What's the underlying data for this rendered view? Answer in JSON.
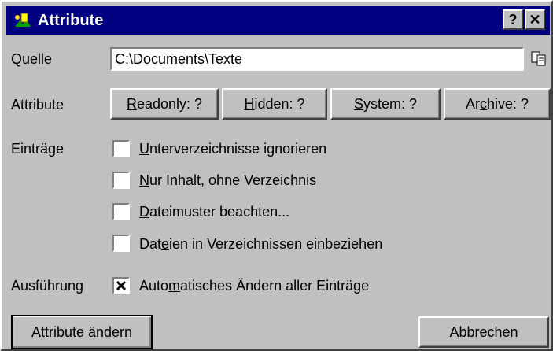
{
  "window": {
    "title": "Attribute",
    "help_label": "?",
    "close_label": "✕"
  },
  "quelle": {
    "label": "Quelle",
    "value": "C:\\Documents\\Texte",
    "browse_icon": "copy-icon"
  },
  "attribute": {
    "label": "Attribute",
    "buttons": [
      {
        "pre": "",
        "key": "R",
        "post": "eadonly: ?"
      },
      {
        "pre": "",
        "key": "H",
        "post": "idden: ?"
      },
      {
        "pre": "",
        "key": "S",
        "post": "ystem: ?"
      },
      {
        "pre": "Ar",
        "key": "c",
        "post": "hive: ?"
      }
    ]
  },
  "eintraege": {
    "label": "Einträge",
    "options": [
      {
        "pre": "",
        "key": "U",
        "post": "nterverzeichnisse ignorieren",
        "checked": false
      },
      {
        "pre": "",
        "key": "N",
        "post": "ur Inhalt, ohne Verzeichnis",
        "checked": false
      },
      {
        "pre": "",
        "key": "D",
        "post": "ateimuster beachten...",
        "checked": false
      },
      {
        "pre": "Dat",
        "key": "e",
        "post": "ien in Verzeichnissen einbeziehen",
        "checked": false
      }
    ]
  },
  "ausfuehrung": {
    "label": "Ausführung",
    "option": {
      "pre": "Auto",
      "key": "m",
      "post": "atisches Ändern aller Einträge",
      "checked": true
    }
  },
  "footer": {
    "apply": {
      "pre": "A",
      "key": "t",
      "post": "tribute ändern"
    },
    "cancel": {
      "pre": "",
      "key": "A",
      "post": "bbrechen"
    }
  }
}
